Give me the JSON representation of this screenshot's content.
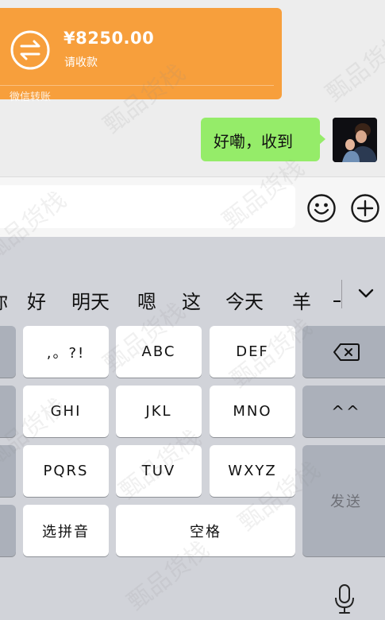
{
  "chat": {
    "transfer": {
      "amount": "¥8250.00",
      "status": "请收款",
      "label": "微信转账"
    },
    "message": {
      "text": "好嘞，收到"
    }
  },
  "input_bar": {
    "value": "",
    "emoji_icon": "emoji-icon",
    "plus_icon": "plus-icon"
  },
  "keyboard": {
    "candidates": [
      "你",
      "好",
      "明天",
      "嗯",
      "这",
      "今天",
      "羊",
      "一"
    ],
    "keys": {
      "punct": ",。?!",
      "abc": "ABC",
      "def": "DEF",
      "ghi": "GHI",
      "jkl": "JKL",
      "mno": "MNO",
      "pqrs": "PQRS",
      "tuv": "TUV",
      "wxyz": "WXYZ",
      "pinyin": "选拼音",
      "space": "空格",
      "emoticon": "^^",
      "send": "发送"
    }
  },
  "watermark": "甄品货栈",
  "colors": {
    "transfer": "#f79f3c",
    "bubble": "#95ec69",
    "keyboard_bg": "#d1d3d9",
    "key_bg": "#ffffff",
    "function_key_bg": "#abb0ba"
  }
}
